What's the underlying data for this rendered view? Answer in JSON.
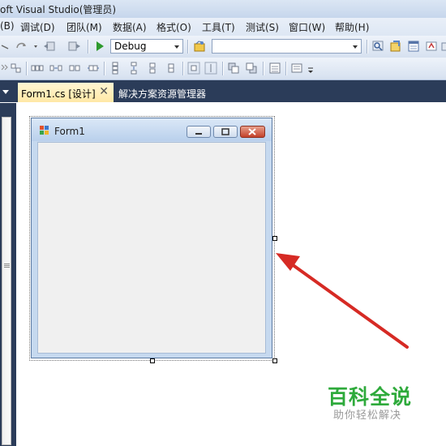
{
  "window": {
    "title": "oft Visual Studio(管理员)"
  },
  "menu": {
    "items": [
      "(B)",
      "调试(D)",
      "团队(M)",
      "数据(A)",
      "格式(O)",
      "工具(T)",
      "测试(S)",
      "窗口(W)",
      "帮助(H)"
    ]
  },
  "toolbar": {
    "config_value": "Debug",
    "find_value": ""
  },
  "tabs": {
    "active": "Form1.cs [设计]",
    "inactive": "解决方案资源管理器"
  },
  "form": {
    "title": "Form1"
  },
  "watermark": {
    "title": "百科全说",
    "subtitle": "助你轻松解决"
  },
  "colors": {
    "arrow": "#d62a24",
    "tab_strip": "#2b3c59",
    "watermark_green": "#2eaa3b"
  }
}
